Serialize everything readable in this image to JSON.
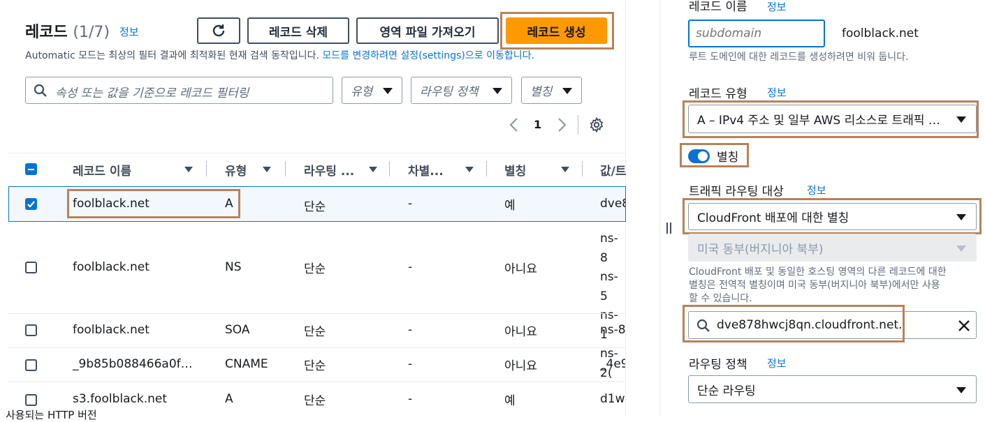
{
  "left": {
    "title": "레코드",
    "count": "(1/7)",
    "info": "정보",
    "refresh_icon": "refresh-icon",
    "delete_label": "레코드 삭제",
    "import_label": "영역 파일 가져오기",
    "create_label": "레코드 생성",
    "description": "Automatic 모드는 최상의 필터 결과에 최적화된 현재 검색 동작입니다.",
    "description_link": "모드를 변경하려면 설정(settings)으로 이동합니다.",
    "search_placeholder": "속성 또는 값을 기준으로 레코드 필터링",
    "filter_type": "유형",
    "filter_routing": "라우팅 정책",
    "filter_alias": "별칭",
    "page_number": "1",
    "columns": [
      "레코드 이름",
      "유형",
      "라우팅 ...",
      "차별...",
      "별칭",
      "값/트"
    ],
    "rows": [
      {
        "name": "foolblack.net",
        "type": "A",
        "routing": "단순",
        "diff": "-",
        "alias": "예",
        "value": [
          "dve8"
        ]
      },
      {
        "name": "foolblack.net",
        "type": "NS",
        "routing": "단순",
        "diff": "-",
        "alias": "아니요",
        "value": [
          "ns-8",
          "ns-5",
          "ns-1",
          "ns-2("
        ]
      },
      {
        "name": "foolblack.net",
        "type": "SOA",
        "routing": "단순",
        "diff": "-",
        "alias": "아니요",
        "value": [
          "ns-8"
        ]
      },
      {
        "name": "_9b85b088466a0f…",
        "type": "CNAME",
        "routing": "단순",
        "diff": "-",
        "alias": "아니요",
        "value": [
          "_4e9"
        ]
      },
      {
        "name": "s3.foolblack.net",
        "type": "A",
        "routing": "단순",
        "diff": "-",
        "alias": "예",
        "value": [
          "d1w"
        ]
      }
    ],
    "bottom_text": "사용되는 HTTP 버전"
  },
  "right": {
    "record_name_label": "레코드 이름",
    "record_name_info": "정보",
    "record_name_placeholder": "subdomain",
    "domain_suffix": "foolblack.net",
    "record_name_desc": "루트 도메인에 대한 레코드를 생성하려면 비워 둡니다.",
    "record_type_label": "레코드 유형",
    "record_type_info": "정보",
    "record_type_value": "A – IPv4 주소 및 일부 AWS 리소스로 트래픽 …",
    "alias_label": "별칭",
    "target_label": "트래픽 라우팅 대상",
    "target_info": "정보",
    "target_value": "CloudFront 배포에 대한 별칭",
    "region_value": "미국 동부(버지니아 북부)",
    "target_desc": [
      "CloudFront 배포 및 동일한 호스팅 영역의 다른 레코드에 대한",
      "별칭은 전역적 별칭이며 미국 동부(버지니아 북부)에서만 사용",
      "할 수 있습니다."
    ],
    "distribution_value": "dve878hwcj8qn.cloudfront.net.",
    "routing_label": "라우팅 정책",
    "routing_info": "정보",
    "routing_value": "단순 라우팅"
  },
  "colors": {
    "accent": "#ff9900",
    "link": "#0972d3",
    "highlight": "#b5835a",
    "toggle": "#0972d3"
  }
}
